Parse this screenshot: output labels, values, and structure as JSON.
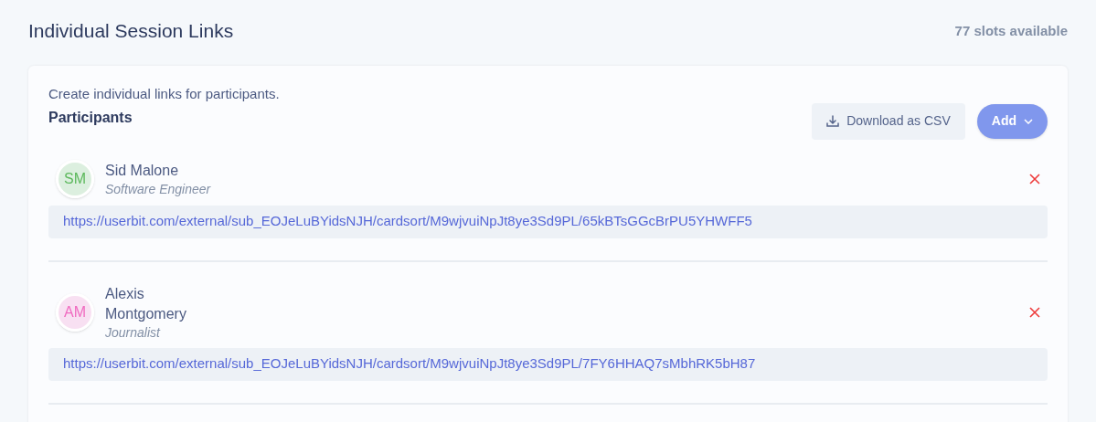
{
  "title": "Individual Session Links",
  "slots": "77 slots available",
  "card": {
    "description": "Create individual links for participants.",
    "heading": "Participants",
    "download_button": "Download as CSV",
    "add_button": "Add"
  },
  "participants": [
    {
      "initials": "SM",
      "color": "#5cb85c",
      "name": "Sid Malone",
      "role": "Software Engineer",
      "link": "https://userbit.com/external/sub_EOJeLuBYidsNJH/cardsort/M9wjvuiNpJt8ye3Sd9PL/65kBTsGGcBrPU5YHWFF5"
    },
    {
      "initials": "AM",
      "color": "#f06ac0",
      "name": "Alexis Montgomery",
      "role": "Journalist",
      "link": "https://userbit.com/external/sub_EOJeLuBYidsNJH/cardsort/M9wjvuiNpJt8ye3Sd9PL/7FY6HHAQ7sMbhRK5bH87"
    }
  ]
}
